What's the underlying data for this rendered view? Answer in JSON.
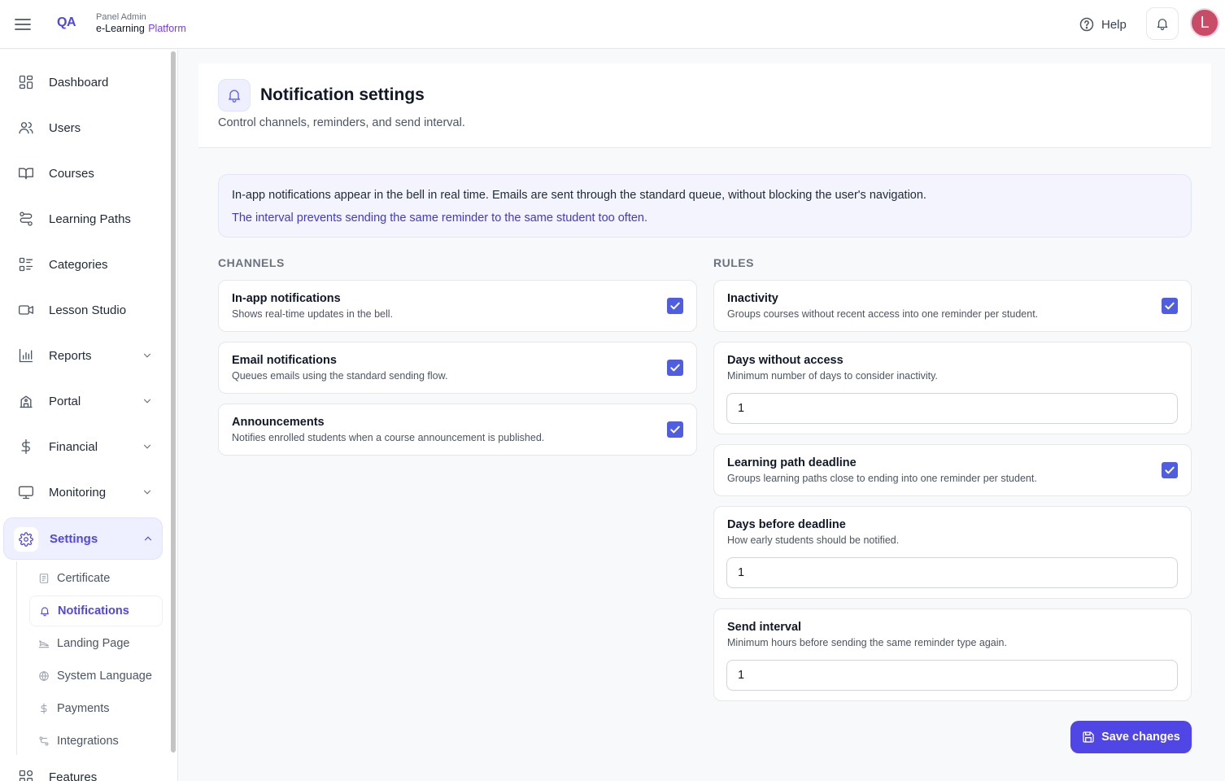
{
  "header": {
    "logo": "QA",
    "brand_sub": "Panel Admin",
    "brand_main": "e-Learning",
    "brand_accent": "Platform",
    "help_label": "Help",
    "avatar_initial": "L"
  },
  "sidebar": {
    "items": [
      {
        "label": "Dashboard",
        "icon": "dashboard-icon"
      },
      {
        "label": "Users",
        "icon": "users-icon"
      },
      {
        "label": "Courses",
        "icon": "book-icon"
      },
      {
        "label": "Learning Paths",
        "icon": "route-icon"
      },
      {
        "label": "Categories",
        "icon": "categories-icon"
      },
      {
        "label": "Lesson Studio",
        "icon": "video-icon"
      },
      {
        "label": "Reports",
        "icon": "bar-chart-icon"
      },
      {
        "label": "Portal",
        "icon": "building-icon"
      },
      {
        "label": "Financial",
        "icon": "dollar-icon"
      },
      {
        "label": "Monitoring",
        "icon": "monitor-icon"
      },
      {
        "label": "Settings",
        "icon": "gear-icon"
      },
      {
        "label": "Features",
        "icon": "features-icon"
      }
    ],
    "settings_children": [
      {
        "label": "Certificate",
        "icon": "certificate-icon"
      },
      {
        "label": "Notifications",
        "icon": "bell-icon"
      },
      {
        "label": "Landing Page",
        "icon": "landing-icon"
      },
      {
        "label": "System Language",
        "icon": "globe-icon"
      },
      {
        "label": "Payments",
        "icon": "dollar-icon"
      },
      {
        "label": "Integrations",
        "icon": "integrations-icon"
      }
    ]
  },
  "page": {
    "title": "Notification settings",
    "subtitle": "Control channels, reminders, and send interval.",
    "info_line1": "In-app notifications appear in the bell in real time. Emails are sent through the standard queue, without blocking the user's navigation.",
    "info_line2": "The interval prevents sending the same reminder to the same student too often.",
    "channels_label": "CHANNELS",
    "rules_label": "RULES"
  },
  "channels": [
    {
      "title": "In-app notifications",
      "desc": "Shows real-time updates in the bell.",
      "checked": true
    },
    {
      "title": "Email notifications",
      "desc": "Queues emails using the standard sending flow.",
      "checked": true
    },
    {
      "title": "Announcements",
      "desc": "Notifies enrolled students when a course announcement is published.",
      "checked": true
    }
  ],
  "rules": [
    {
      "title": "Inactivity",
      "desc": "Groups courses without recent access into one reminder per student.",
      "checked": true
    },
    {
      "title": "Days without access",
      "desc": "Minimum number of days to consider inactivity.",
      "value": "1"
    },
    {
      "title": "Learning path deadline",
      "desc": "Groups learning paths close to ending into one reminder per student.",
      "checked": true
    },
    {
      "title": "Days before deadline",
      "desc": "How early students should be notified.",
      "value": "1"
    },
    {
      "title": "Send interval",
      "desc": "Minimum hours before sending the same reminder type again.",
      "value": "1"
    }
  ],
  "actions": {
    "save_label": "Save changes"
  },
  "colors": {
    "accent": "#4f46e5",
    "checkbox": "#4f5ee0",
    "avatar": "#c84c67"
  }
}
